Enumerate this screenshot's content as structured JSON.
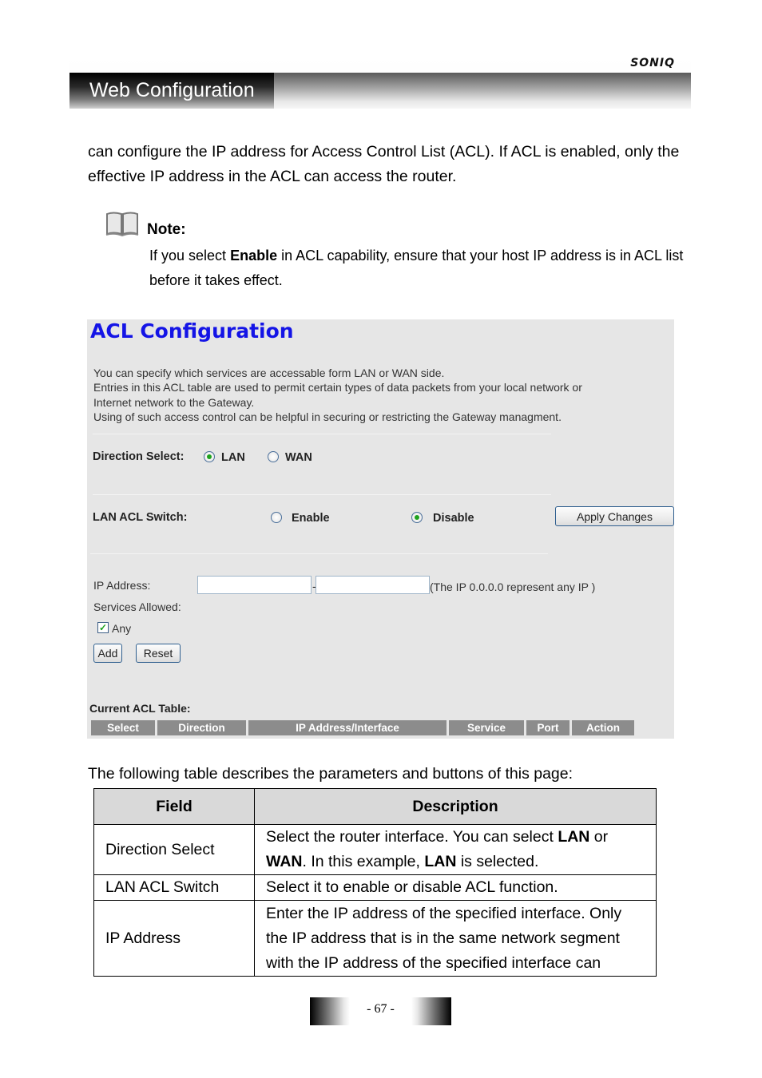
{
  "header": {
    "brand": "SONIQ",
    "section_title": "Web Configuration"
  },
  "intro_paragraph": "can configure the IP address for Access Control List (ACL). If ACL is enabled, only the effective IP address in the ACL can access the router.",
  "note": {
    "icon": "book-icon",
    "label": "Note:",
    "text_before": "If you select ",
    "text_bold": "Enable",
    "text_after": " in ACL capability, ensure that your host IP address is in ACL list before it takes effect."
  },
  "screenshot": {
    "title": "ACL Configuration",
    "intro_lines": [
      "You can specify which services are accessable form LAN or WAN side.",
      "Entries in this ACL table are used to permit certain types of data packets from your local network or",
      "Internet network to the Gateway.",
      "Using of such access control can be helpful in securing or restricting the Gateway managment."
    ],
    "direction": {
      "label": "Direction Select:",
      "options": [
        {
          "label": "LAN",
          "selected": true
        },
        {
          "label": "WAN",
          "selected": false
        }
      ]
    },
    "switch": {
      "label": "LAN ACL Switch:",
      "options": [
        {
          "label": "Enable",
          "selected": false
        },
        {
          "label": "Disable",
          "selected": true
        }
      ],
      "apply_label": "Apply Changes"
    },
    "ip": {
      "label": "IP Address:",
      "start_value": "",
      "end_value": "",
      "separator": "-",
      "hint": "(The IP 0.0.0.0 represent any IP )"
    },
    "services": {
      "label": "Services Allowed:",
      "any_label": "Any",
      "any_checked": true
    },
    "buttons": {
      "add": "Add",
      "reset": "Reset"
    },
    "current_table": {
      "label": "Current ACL Table:",
      "columns": [
        "Select",
        "Direction",
        "IP Address/Interface",
        "Service",
        "Port",
        "Action"
      ]
    }
  },
  "description_table": {
    "caption": "The following table describes the parameters and buttons of this page:",
    "headers": [
      "Field",
      "Description"
    ],
    "rows": [
      {
        "field": "Direction Select",
        "desc_parts": [
          {
            "t": "Select the router interface. You can select ",
            "b": false
          },
          {
            "t": "LAN",
            "b": true
          },
          {
            "t": " or ",
            "b": false
          },
          {
            "t": "WAN",
            "b": true
          },
          {
            "t": ". In this example, ",
            "b": false
          },
          {
            "t": "LAN",
            "b": true
          },
          {
            "t": " is selected.",
            "b": false
          }
        ]
      },
      {
        "field": "LAN ACL Switch",
        "desc_parts": [
          {
            "t": "Select it to enable or disable ACL function.",
            "b": false
          }
        ]
      },
      {
        "field": "IP Address",
        "desc_parts": [
          {
            "t": "Enter the IP address of the specified interface. Only the IP address that is in the same network segment with the IP address of the specified interface can",
            "b": false
          }
        ]
      }
    ]
  },
  "footer": {
    "page_number": "- 67 -"
  }
}
